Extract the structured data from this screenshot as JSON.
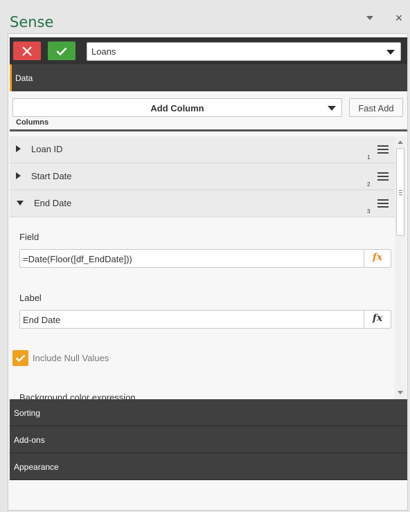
{
  "window": {
    "title": "Sense",
    "dropdown_icon": "chevron-down-icon",
    "close_label": "×"
  },
  "toolbar": {
    "cancel_icon": "close-icon",
    "confirm_icon": "checkmark-icon",
    "cancel_color": "#e04a4a",
    "confirm_color": "#46a43f",
    "table_select_value": "Loans"
  },
  "sections": {
    "data": "Data",
    "sorting": "Sorting",
    "addons": "Add-ons",
    "appearance": "Appearance"
  },
  "columns_panel": {
    "add_column_label": "Add Column",
    "fast_add_label": "Fast Add",
    "columns_heading": "Columns",
    "items": [
      {
        "name": "Loan ID",
        "index": "1",
        "expanded": false
      },
      {
        "name": "Start Date",
        "index": "2",
        "expanded": false
      },
      {
        "name": "End Date",
        "index": "3",
        "expanded": true
      }
    ]
  },
  "column_detail": {
    "field_label": "Field",
    "field_value": "=Date(Floor([df_EndDate]))",
    "label_label": "Label",
    "label_value": "End Date",
    "fx_text": "fx",
    "include_null_label": "Include Null Values",
    "include_null_checked": true,
    "background_expr_label": "Background color expression"
  },
  "colors": {
    "accent": "#f0a020",
    "title_green": "#217346",
    "fx_active": "#e8871e"
  }
}
